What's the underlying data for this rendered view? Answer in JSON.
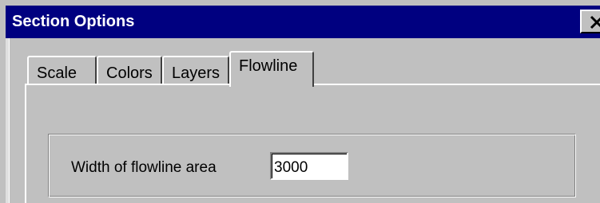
{
  "window": {
    "title": "Section Options",
    "close_icon": "close-icon"
  },
  "tabs": [
    {
      "label": "Scale",
      "active": false
    },
    {
      "label": "Colors",
      "active": false
    },
    {
      "label": "Layers",
      "active": false
    },
    {
      "label": "Flowline",
      "active": true
    }
  ],
  "flowline": {
    "width_label": "Width of flowline area",
    "width_value": "3000"
  },
  "colors": {
    "titlebar": "#000080",
    "face": "#c0c0c0"
  }
}
